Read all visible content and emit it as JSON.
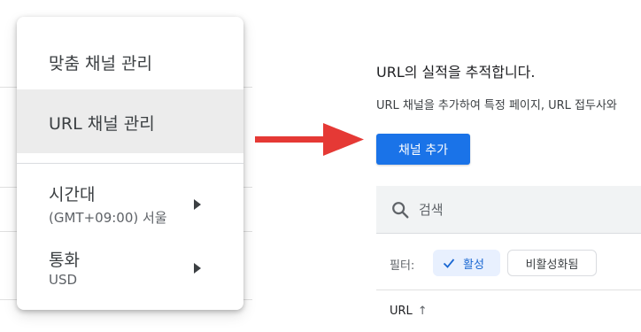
{
  "menu": {
    "items": [
      {
        "label": "맞춤 채널 관리"
      },
      {
        "label": "URL 채널 관리"
      },
      {
        "label": "시간대",
        "sub": "(GMT+09:00) 서울"
      },
      {
        "label": "통화",
        "sub": "USD"
      }
    ]
  },
  "panel": {
    "heading": "URL의 실적을 추적합니다.",
    "description": "URL 채널을 추가하여 특정 페이지, URL 접두사와",
    "add_button": "채널 추가",
    "search_placeholder": "검색",
    "filter_label": "필터:",
    "filter_active": "활성",
    "filter_inactive": "비활성화됨",
    "column_header": "URL",
    "sort_icon": "↑"
  },
  "colors": {
    "accent": "#1a73e8",
    "arrow": "#e53935",
    "chip_active_bg": "#e8f0fe",
    "selected_row": "#ececec"
  },
  "icons": [
    "search-icon",
    "check-icon",
    "caret-right-icon",
    "sort-arrow-up-icon",
    "red-arrow"
  ]
}
